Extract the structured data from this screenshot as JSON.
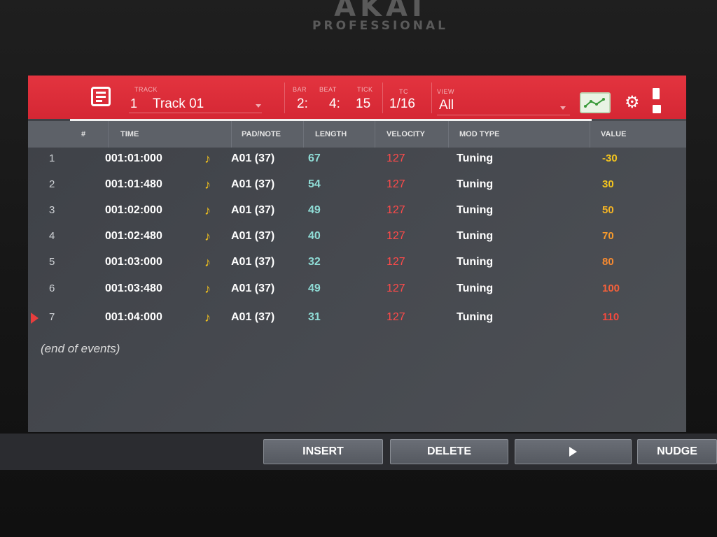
{
  "brand": {
    "name": "AKAI",
    "sub": "PROFESSIONAL"
  },
  "header": {
    "track_label": "TRACK",
    "track_number": "1",
    "track_name": "Track 01",
    "bar_label": "BAR",
    "bar_value": "2:",
    "beat_label": "BEAT",
    "beat_value": "4:",
    "tick_label": "TICK",
    "tick_value": "15",
    "tc_label": "TC",
    "tc_value": "1/16",
    "view_label": "VIEW",
    "view_value": "All"
  },
  "columns": {
    "num": "#",
    "time": "TIME",
    "pad": "PAD/NOTE",
    "length": "LENGTH",
    "velocity": "VELOCITY",
    "mod_type": "MOD TYPE",
    "value": "VALUE"
  },
  "events": [
    {
      "num": "1",
      "time": "001:01:000",
      "pad": "A01 (37)",
      "length": "67",
      "velocity": "127",
      "mod_type": "Tuning",
      "value": "-30",
      "value_color": "#f4c51e"
    },
    {
      "num": "2",
      "time": "001:01:480",
      "pad": "A01 (37)",
      "length": "54",
      "velocity": "127",
      "mod_type": "Tuning",
      "value": "30",
      "value_color": "#f4c51e"
    },
    {
      "num": "3",
      "time": "001:02:000",
      "pad": "A01 (37)",
      "length": "49",
      "velocity": "127",
      "mod_type": "Tuning",
      "value": "50",
      "value_color": "#f5b424"
    },
    {
      "num": "4",
      "time": "001:02:480",
      "pad": "A01 (37)",
      "length": "40",
      "velocity": "127",
      "mod_type": "Tuning",
      "value": "70",
      "value_color": "#f79a2c"
    },
    {
      "num": "5",
      "time": "001:03:000",
      "pad": "A01 (37)",
      "length": "32",
      "velocity": "127",
      "mod_type": "Tuning",
      "value": "80",
      "value_color": "#f78a30"
    },
    {
      "num": "6",
      "time": "001:03:480",
      "pad": "A01 (37)",
      "length": "49",
      "velocity": "127",
      "mod_type": "Tuning",
      "value": "100",
      "value_color": "#f4603a"
    },
    {
      "num": "7",
      "time": "001:04:000",
      "pad": "A01 (37)",
      "length": "31",
      "velocity": "127",
      "mod_type": "Tuning",
      "value": "110",
      "value_color": "#f2493e"
    }
  ],
  "end_text": "(end of events)",
  "buttons": {
    "insert": "INSERT",
    "delete": "DELETE",
    "play_icon": "play-icon",
    "nudge": "NUDGE"
  },
  "colors": {
    "header_red": "#e3343f",
    "velocity_red": "#ff4a4a",
    "length_cyan": "#8fdcd6",
    "note_icon_yellow": "#f3c21c"
  }
}
